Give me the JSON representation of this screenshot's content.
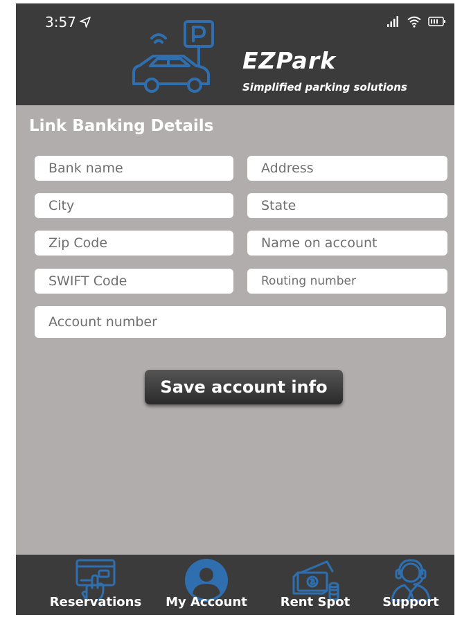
{
  "status_bar": {
    "time": "3:57"
  },
  "brand": {
    "name": "EZPark",
    "tagline": "Simplified parking solutions"
  },
  "form": {
    "title": "Link Banking Details",
    "fields": {
      "bank_name": "Bank name",
      "address": "Address",
      "city": "City",
      "state": "State",
      "zip_code": "Zip Code",
      "name_on_account": "Name on account",
      "swift_code": "SWIFT Code",
      "routing_number": "Routing number",
      "account_number": "Account number"
    },
    "save_label": "Save account info"
  },
  "nav": {
    "items": [
      {
        "label": "Reservations",
        "icon": "reservations-card-icon"
      },
      {
        "label": "My Account",
        "icon": "user-icon"
      },
      {
        "label": "Rent Spot",
        "icon": "money-icon"
      },
      {
        "label": "Support",
        "icon": "headset-icon"
      }
    ]
  },
  "colors": {
    "header": "#3b3b3b",
    "background": "#b1adac",
    "accent": "#2f6fb0",
    "text_light": "#ffffff"
  }
}
